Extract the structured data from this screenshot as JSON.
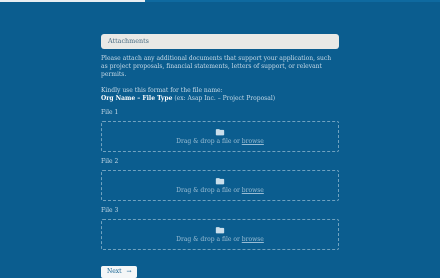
{
  "progress": {
    "value_fraction": 0.33
  },
  "section": {
    "title": "Attachments",
    "intro": "Please attach any additional documents that support your application, such as project proposals, financial statements, letters of support, or relevant permits."
  },
  "naming": {
    "format_label": "Kindly use this format for the file name:",
    "format_strong": "Org Name – File Type",
    "format_example": "(ex: Asap Inc. – Project Proposal)"
  },
  "files": [
    {
      "label": "File 1",
      "drop_text": "Drag & drop a file or",
      "browse_text": "browse"
    },
    {
      "label": "File 2",
      "drop_text": "Drag & drop a file or",
      "browse_text": "browse"
    },
    {
      "label": "File 3",
      "drop_text": "Drag & drop a file or",
      "browse_text": "browse"
    }
  ],
  "actions": {
    "next_label": "Next",
    "next_icon": "arrow-right-icon"
  },
  "colors": {
    "background": "#0b5d8f",
    "header_bg": "#e9e9e6",
    "button_bg": "#f4f6f7"
  }
}
